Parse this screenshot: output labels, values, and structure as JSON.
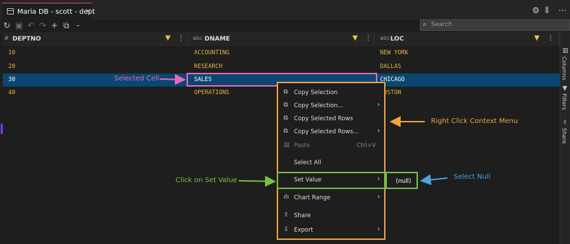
{
  "tab": {
    "title": "Maria DB - scott - dept",
    "close": "×"
  },
  "window_icons": {
    "settings": "⚙",
    "split": "⫴",
    "more": "⋯"
  },
  "toolbar": {
    "refresh": "↻",
    "save": "▣",
    "undo": "↶",
    "redo": "↷",
    "add": "+",
    "copy": "⧉",
    "remove": "-",
    "search_placeholder": "Search"
  },
  "columns": [
    {
      "type": "#",
      "name": "DEPTNO"
    },
    {
      "type": "abc",
      "name": "DNAME"
    },
    {
      "type": "abc",
      "name": "LOC"
    }
  ],
  "header_icons": {
    "filter": "▼",
    "more": "⋮"
  },
  "rows": [
    [
      "10",
      "ACCOUNTING",
      "NEW YORK"
    ],
    [
      "20",
      "RESEARCH",
      "DALLAS"
    ],
    [
      "30",
      "SALES",
      "CHICAGO"
    ],
    [
      "40",
      "OPERATIONS",
      "BOSTON"
    ]
  ],
  "selected_row_index": 2,
  "side_panel": {
    "columns": "Columns",
    "filters": "Filters",
    "share": "Share"
  },
  "context_menu": {
    "items": [
      {
        "label": "Copy Selection",
        "icon": "copy-icon",
        "glyph": "⧉",
        "submenu": false
      },
      {
        "label": "Copy Selection...",
        "icon": "copy-icon",
        "glyph": "⧉",
        "submenu": true
      },
      {
        "label": "Copy Selected Rows",
        "icon": "copy-icon",
        "glyph": "⧉",
        "submenu": false
      },
      {
        "label": "Copy Selected Rows...",
        "icon": "copy-icon",
        "glyph": "⧉",
        "submenu": true
      },
      {
        "label": "Paste",
        "icon": "paste-icon",
        "glyph": "📋",
        "shortcut": "Ctrl+V",
        "disabled": true
      },
      {
        "label": "Select All",
        "icon": "",
        "glyph": "",
        "submenu": false
      },
      {
        "label": "Set Value",
        "icon": "",
        "glyph": "",
        "submenu": true
      },
      {
        "label": "Chart Range",
        "icon": "chart-icon",
        "glyph": "▮",
        "submenu": true
      },
      {
        "label": "Share",
        "icon": "share-icon",
        "glyph": "⇪",
        "submenu": false
      },
      {
        "label": "Export",
        "icon": "export-icon",
        "glyph": "⇩",
        "submenu": true
      }
    ],
    "submenu_arrow": "›",
    "submenu_value": "(null)"
  },
  "annotations": {
    "selected_cell": "Selected Cell",
    "context_menu": "Right Click Context Menu",
    "set_value": "Click on Set Value",
    "select_null": "Select Null"
  },
  "colors": {
    "accent_tab": "#e8467c",
    "cell_text": "#e3b341",
    "selected_row": "#094771",
    "menu_border": "#f0a53c",
    "set_value_border": "#7ac143",
    "selected_cell_border": "#e86ab8",
    "null_arrow": "#4aa3df"
  }
}
